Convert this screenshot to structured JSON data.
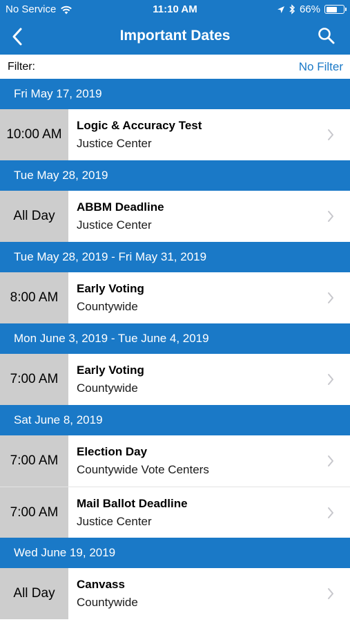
{
  "status_bar": {
    "carrier": "No Service",
    "time": "11:10 AM",
    "battery": "66%",
    "battery_level": 0.66
  },
  "nav": {
    "title": "Important Dates",
    "back_icon": "back-chevron-icon",
    "search_icon": "search-icon"
  },
  "filter": {
    "label": "Filter:",
    "value": "No Filter"
  },
  "groups": [
    {
      "date": "Fri May 17, 2019",
      "events": [
        {
          "time": "10:00 AM",
          "name": "Logic & Accuracy Test",
          "location": "Justice Center"
        }
      ]
    },
    {
      "date": "Tue May 28, 2019",
      "events": [
        {
          "time": "All Day",
          "name": "ABBM Deadline",
          "location": "Justice Center"
        }
      ]
    },
    {
      "date": "Tue May 28, 2019 - Fri May 31, 2019",
      "events": [
        {
          "time": "8:00 AM",
          "name": "Early Voting",
          "location": "Countywide"
        }
      ]
    },
    {
      "date": "Mon June 3, 2019 - Tue June 4, 2019",
      "events": [
        {
          "time": "7:00 AM",
          "name": "Early Voting",
          "location": "Countywide"
        }
      ]
    },
    {
      "date": "Sat June 8, 2019",
      "events": [
        {
          "time": "7:00 AM",
          "name": "Election Day",
          "location": "Countywide Vote Centers"
        },
        {
          "time": "7:00 AM",
          "name": "Mail Ballot Deadline",
          "location": "Justice Center"
        }
      ]
    },
    {
      "date": "Wed June 19, 2019",
      "events": [
        {
          "time": "All Day",
          "name": "Canvass",
          "location": "Countywide"
        }
      ]
    }
  ],
  "colors": {
    "accent": "#1a79c7",
    "time_cell": "#cdcdcd",
    "chevron": "#c7c7cc"
  }
}
